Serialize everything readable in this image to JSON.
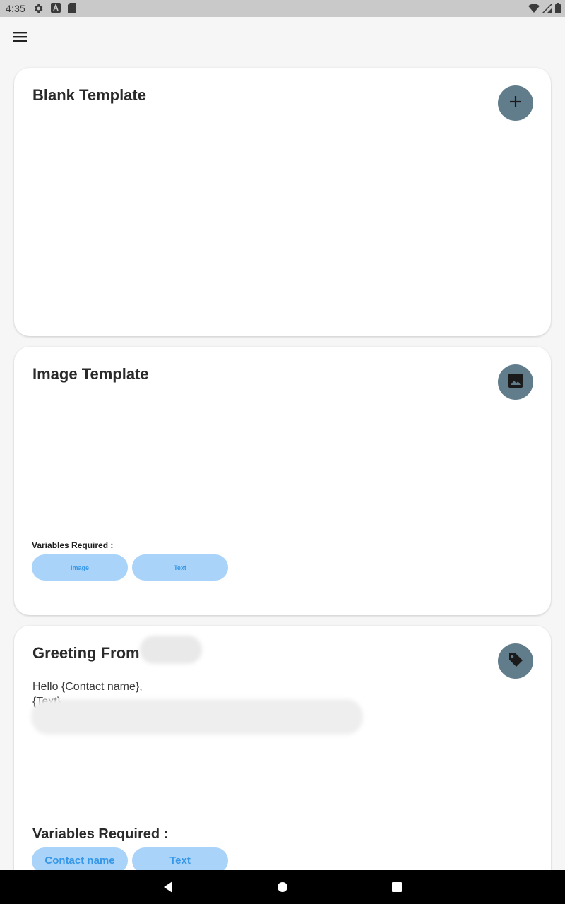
{
  "status_bar": {
    "time": "4:35",
    "icons": [
      "gear-icon",
      "font-icon",
      "sd-card-icon",
      "wifi-icon",
      "signal-icon",
      "battery-icon"
    ]
  },
  "app_bar": {
    "menu_icon": "hamburger-menu-icon"
  },
  "cards": [
    {
      "title": "Blank Template",
      "fab_icon": "plus-icon"
    },
    {
      "title": "Image Template",
      "fab_icon": "image-icon",
      "variables_label": "Variables Required :",
      "chips": [
        "Image",
        "Text"
      ]
    },
    {
      "title": "Greeting From",
      "fab_icon": "tag-icon",
      "body_lines": [
        "Hello {Contact name},",
        "{Text}"
      ],
      "variables_label": "Variables Required :",
      "chips": [
        "Contact name",
        "Text"
      ]
    }
  ],
  "nav_bar": {
    "icons": [
      "back-icon",
      "home-icon",
      "recent-apps-icon"
    ]
  },
  "colors": {
    "fab": "#617d8c",
    "chip_bg": "#a9d3f8",
    "chip_text": "#3597e8",
    "status_bar": "#c9c9c9"
  }
}
